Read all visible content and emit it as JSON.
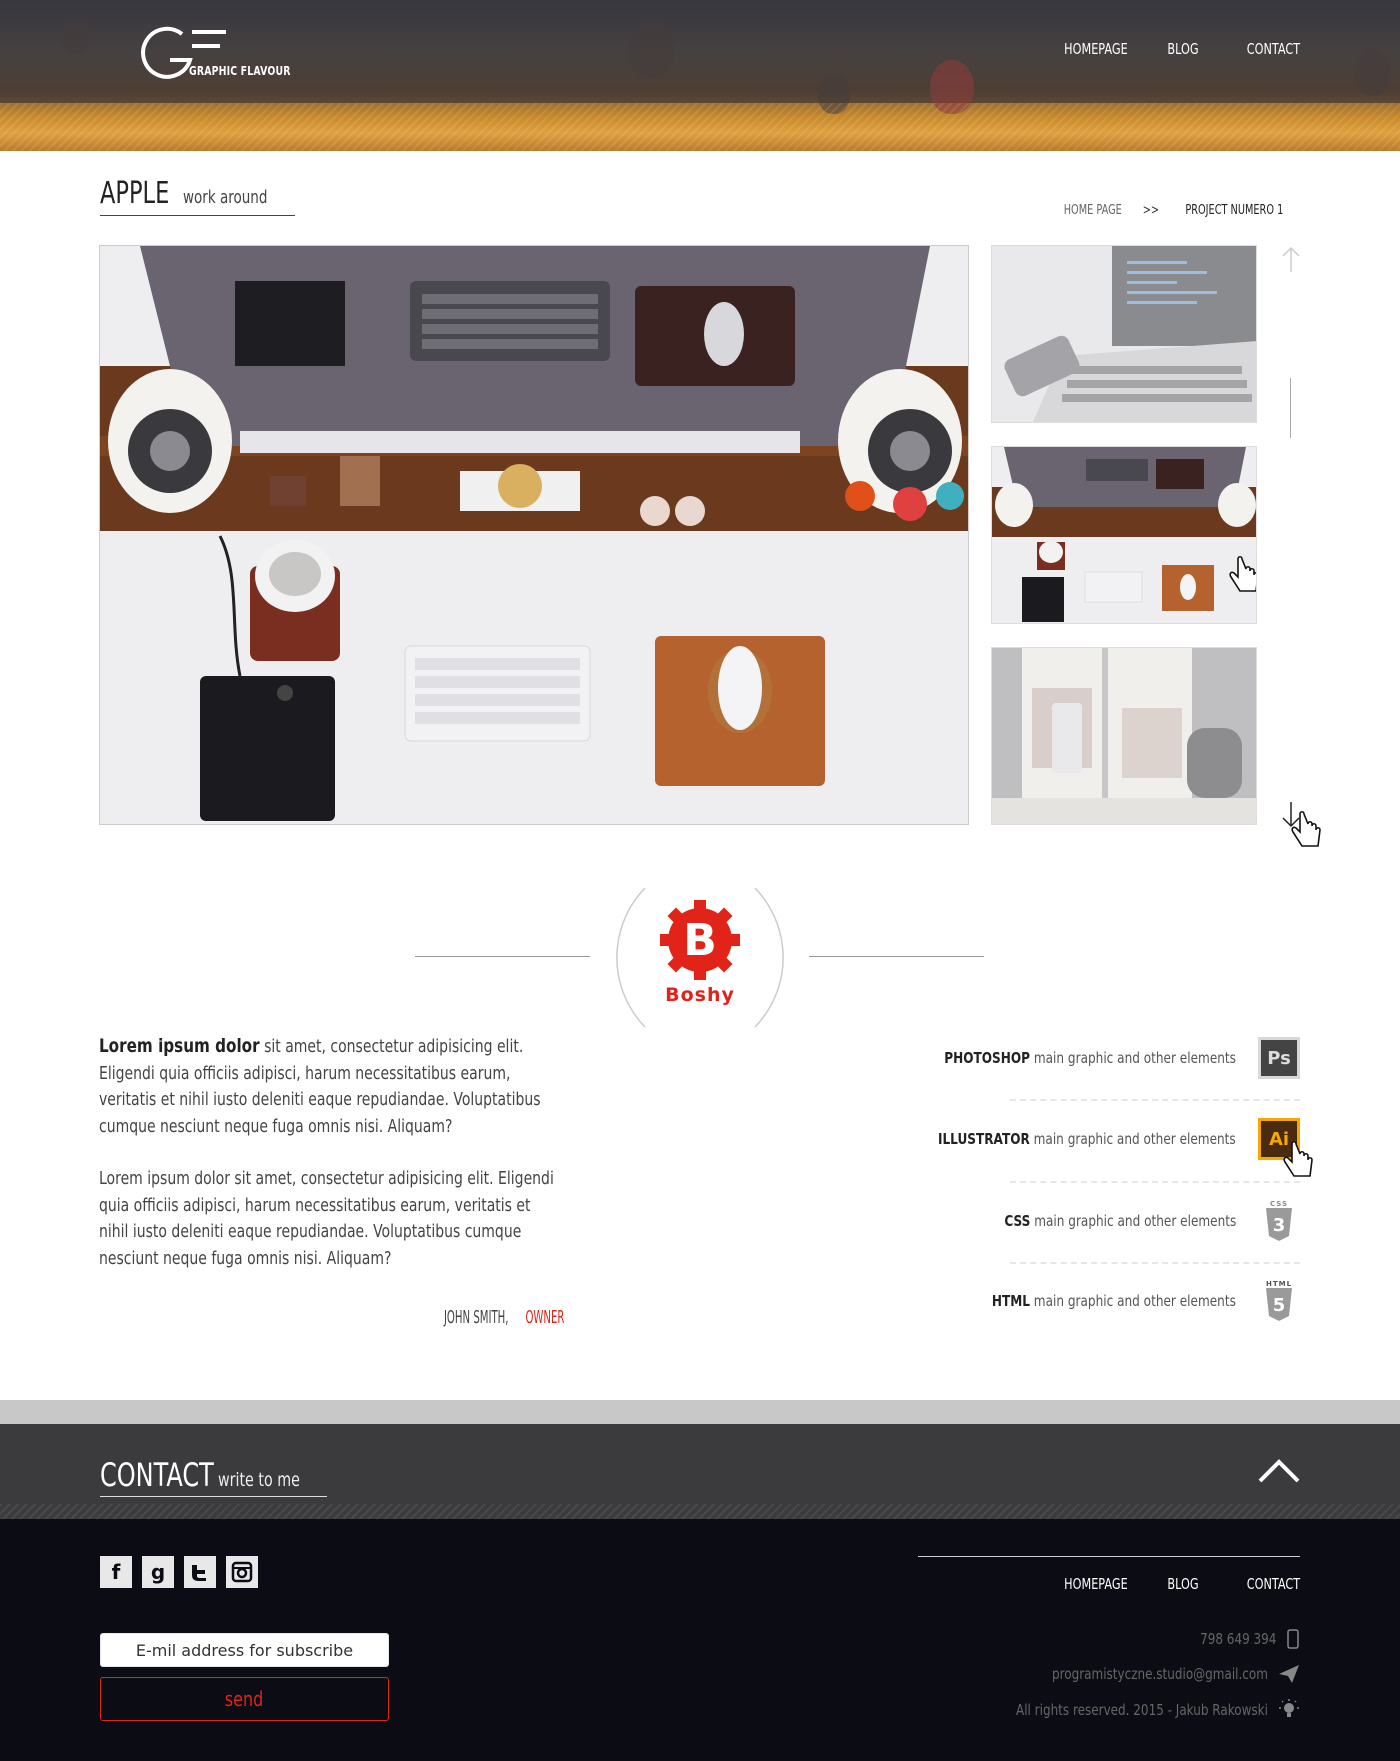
{
  "header": {
    "logo_text": "GRAPHIC FLAVOUR",
    "nav": [
      "HOMEPAGE",
      "BLOG",
      "CONTACT"
    ]
  },
  "page": {
    "title": "APPLE",
    "subtitle": "work around",
    "breadcrumb": [
      "HOME PAGE",
      "PROJECT NUMERO 1"
    ],
    "breadcrumb_sep": ">>"
  },
  "brand": {
    "letter": "B",
    "name": "Boshy",
    "color": "#e2231a"
  },
  "content": {
    "p1_bold": "Lorem ipsum dolor",
    "p1_rest": " sit amet, consectetur adipisicing elit. Eligendi quia officiis adipisci, harum necessitatibus earum, veritatis et nihil iusto deleniti eaque repudiandae. Voluptatibus cumque nesciunt neque fuga omnis nisi. Aliquam?",
    "p2": "Lorem ipsum dolor sit amet, consectetur adipisicing elit. Eligendi quia officiis adipisci, harum necessitatibus earum, veritatis et nihil iusto deleniti eaque repudiandae. Voluptatibus cumque nesciunt neque fuga omnis nisi. Aliquam?",
    "signature_name": "JOHN SMITH,",
    "signature_role": "OWNER"
  },
  "skills": [
    {
      "name": "PHOTOSHOP",
      "desc": "main graphic and other elements",
      "icon": "Ps"
    },
    {
      "name": "ILLUSTRATOR",
      "desc": "main graphic and other elements",
      "icon": "Ai"
    },
    {
      "name": "CSS",
      "desc": "main graphic and other elements",
      "icon": "3"
    },
    {
      "name": "HTML",
      "desc": "main graphic and other elements",
      "icon": "5"
    }
  ],
  "skill_icon_tags": {
    "css": "CSS",
    "html": "HTML"
  },
  "contact": {
    "title": "CONTACT",
    "subtitle": "write to me"
  },
  "footer": {
    "email_placeholder": "E-mil address for subscribe",
    "send_label": "send",
    "nav": [
      "HOMEPAGE",
      "BLOG",
      "CONTACT"
    ],
    "phone": "798 649 394",
    "email": "programistyczne.studio@gmail.com",
    "copyright": "All rights reserved. 2015 - Jakub Rakowski"
  },
  "social_icons": {
    "facebook": "f",
    "google": "g"
  },
  "colors": {
    "accent": "#e2231a",
    "footer_bg": "#0c0c14",
    "contact_band": "#3b3b3d",
    "illustrator": "#f7a800"
  }
}
